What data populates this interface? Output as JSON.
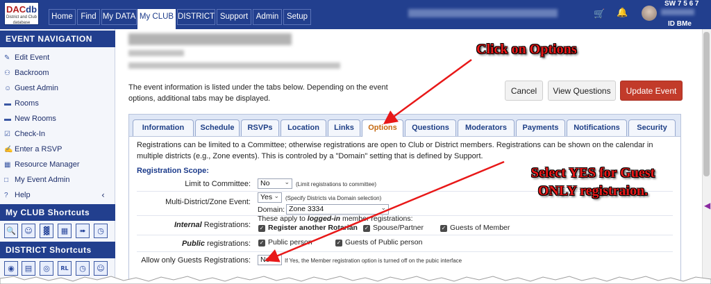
{
  "logo": {
    "text_dac": "DAC",
    "text_db": "db",
    "tagline": "District and Club database"
  },
  "topnav": [
    {
      "label": "Home"
    },
    {
      "label": "Find"
    },
    {
      "label": "My DATA"
    },
    {
      "label": "My CLUB"
    },
    {
      "label": "DISTRICT"
    },
    {
      "label": "Support"
    },
    {
      "label": "Admin"
    },
    {
      "label": "Setup"
    }
  ],
  "header_right": {
    "sw_label": "SW 7 5 6 7",
    "id_label": "ID BMe",
    "cart_icon": "cart-icon",
    "bell_icon": "bell-icon"
  },
  "sidebar": {
    "event_nav_title": "EVENT NAVIGATION",
    "items": [
      {
        "label": "Edit Event",
        "icon": "edit-icon"
      },
      {
        "label": "Backroom",
        "icon": "people-icon"
      },
      {
        "label": "Guest Admin",
        "icon": "user-icon"
      },
      {
        "label": "Rooms",
        "icon": "bed-icon"
      },
      {
        "label": "New Rooms",
        "icon": "bed-icon"
      },
      {
        "label": "Check-In",
        "icon": "check-icon"
      },
      {
        "label": "Enter a RSVP",
        "icon": "pencil-icon"
      },
      {
        "label": "Resource Manager",
        "icon": "grid-icon"
      },
      {
        "label": "My Event Admin",
        "icon": "doc-icon"
      },
      {
        "label": "Help",
        "icon": "question-icon"
      }
    ],
    "club_shortcuts_title": "My CLUB Shortcuts",
    "district_shortcuts_title": "DISTRICT Shortcuts"
  },
  "buttons": {
    "cancel": "Cancel",
    "view_questions": "View Questions",
    "update_event": "Update Event"
  },
  "intro_text": "The event information is listed under the tabs below. Depending on the event options, additional tabs may be displayed.",
  "tabs": [
    {
      "label": "Information"
    },
    {
      "label": "Schedule"
    },
    {
      "label": "RSVPs"
    },
    {
      "label": "Location"
    },
    {
      "label": "Links"
    },
    {
      "label": "Options"
    },
    {
      "label": "Questions"
    },
    {
      "label": "Moderators"
    },
    {
      "label": "Payments"
    },
    {
      "label": "Notifications"
    },
    {
      "label": "Security"
    }
  ],
  "active_tab": "Options",
  "options": {
    "description": "Registrations can be limited to a Committee; otherwise registrations are open to Club or District members. Registrations can be shown on the calendar in multiple districts (e.g., Zone events). This is controled by a \"Domain\" setting that is defined by Support.",
    "registration_scope_label": "Registration Scope:",
    "limit_committee": {
      "label": "Limit to Committee:",
      "value": "No",
      "hint": "(Limit registrations to committee)"
    },
    "multi_district": {
      "label": "Multi-District/Zone Event:",
      "value": "Yes",
      "hint": "(Specify Districts via Domain selection)",
      "domain_label": "Domain:",
      "domain_value": "Zone 3334"
    },
    "internal": {
      "label_em": "Internal",
      "label_rest": " Registrations:",
      "note_pre": "These apply to ",
      "note_em": "logged-in",
      "note_post": " member registrations:",
      "opt1": "Register another Rotarian",
      "opt2": "Spouse/Partner",
      "opt3": "Guests of Member"
    },
    "public": {
      "label_em": "Public",
      "label_rest": " registrations:",
      "opt1": "Public person",
      "opt2": "Guests of Public person"
    },
    "guests_only": {
      "label": "Allow only Guests Registrations:",
      "value": "No",
      "hint": "If Yes, the Member registration option is turned off on the pubic interface"
    }
  },
  "annotations": {
    "click_options": "Click on Options",
    "select_yes_line1": "Select YES for Guest",
    "select_yes_line2": "ONLY registraion.",
    "color": "#e81818"
  }
}
